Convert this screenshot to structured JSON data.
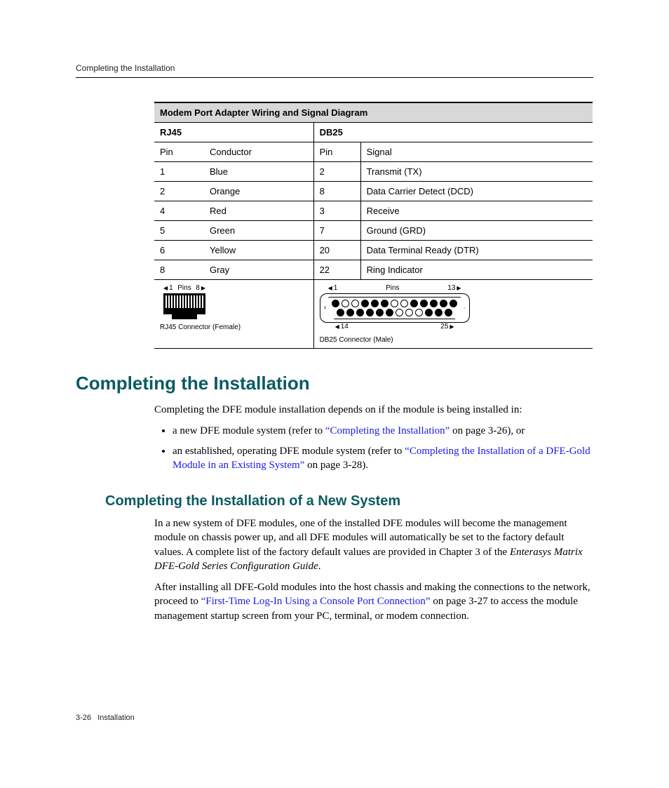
{
  "header": {
    "section_label": "Completing the Installation"
  },
  "table": {
    "title": "Modem Port Adapter Wiring and Signal Diagram",
    "rj45_label": "RJ45",
    "db25_label": "DB25",
    "cols": {
      "pin": "Pin",
      "conductor": "Conductor",
      "signal": "Signal"
    },
    "rows": [
      {
        "rj45_pin": "1",
        "conductor": "Blue",
        "db25_pin": "2",
        "signal": "Transmit (TX)"
      },
      {
        "rj45_pin": "2",
        "conductor": "Orange",
        "db25_pin": "8",
        "signal": "Data Carrier Detect (DCD)"
      },
      {
        "rj45_pin": "4",
        "conductor": "Red",
        "db25_pin": "3",
        "signal": "Receive"
      },
      {
        "rj45_pin": "5",
        "conductor": "Green",
        "db25_pin": "7",
        "signal": "Ground (GRD)"
      },
      {
        "rj45_pin": "6",
        "conductor": "Yellow",
        "db25_pin": "20",
        "signal": "Data Terminal Ready (DTR)"
      },
      {
        "rj45_pin": "8",
        "conductor": "Gray",
        "db25_pin": "22",
        "signal": "Ring Indicator"
      }
    ],
    "diagram": {
      "pins_label": "Pins",
      "rj45_pin_start": "1",
      "rj45_pin_end": "8",
      "rj45_caption": "RJ45 Connector (Female)",
      "db25_top_start": "1",
      "db25_top_end": "13",
      "db25_bot_start": "14",
      "db25_bot_end": "25",
      "db25_caption": "DB25 Connector (Male)"
    }
  },
  "section1": {
    "heading": "Completing the Installation",
    "intro": "Completing the DFE module installation depends on if the module is being installed in:",
    "bullet1_pre": "a new DFE module system (refer to ",
    "bullet1_link": "“Completing the Installation”",
    "bullet1_post": " on page 3-26), or",
    "bullet2_pre": "an established, operating DFE module system (refer to ",
    "bullet2_link": "“Completing the Installation of a DFE-Gold Module in an Existing System”",
    "bullet2_post": " on page 3-28)."
  },
  "section2": {
    "heading": "Completing the Installation of a New System",
    "para1_a": "In a new system of DFE modules, one of the installed DFE modules will become the management module on chassis power up, and all DFE modules will automatically be set to the factory default values. A complete list of the factory default values are provided in Chapter 3 of the ",
    "para1_em": "Enterasys Matrix DFE-Gold Series Configuration Guide",
    "para1_b": ".",
    "para2_a": "After installing all DFE-Gold modules into the host chassis and making the connections to the network, proceed to ",
    "para2_link": "“First-Time Log-In Using a Console Port Connection”",
    "para2_b": " on page 3-27 to access the module management startup screen from your PC, terminal, or modem connection."
  },
  "footer": {
    "page": "3-26",
    "label": "Installation"
  }
}
